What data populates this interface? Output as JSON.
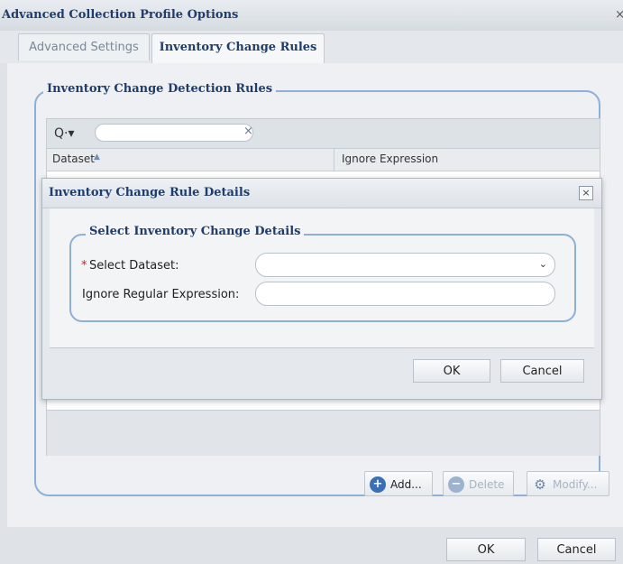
{
  "window": {
    "title": "Advanced Collection Profile Options",
    "close_glyph": "×",
    "close_icon": "close-icon"
  },
  "tabs": [
    {
      "label": "Advanced Settings",
      "active": false
    },
    {
      "label": "Inventory Change Rules",
      "active": true
    }
  ],
  "group": {
    "legend": "Inventory Change Detection Rules"
  },
  "grid": {
    "search_icon": "search-icon",
    "search_glyph": "Q·▾",
    "clear_glyph": "×",
    "search_value": "",
    "columns": [
      {
        "label": "Dataset",
        "sort": "ascending"
      },
      {
        "label": "Ignore Expression"
      }
    ],
    "sort_glyph": "▲",
    "rows": []
  },
  "actions": {
    "add": {
      "label": "Add...",
      "icon": "add-icon",
      "glyph": "+",
      "enabled": true
    },
    "delete": {
      "label": "Delete",
      "icon": "delete-icon",
      "glyph": "−",
      "enabled": false
    },
    "modify": {
      "label": "Modify...",
      "icon": "modify-icon",
      "glyph": "⚙",
      "enabled": false
    }
  },
  "footer": {
    "ok": "OK",
    "cancel": "Cancel"
  },
  "dialog": {
    "title": "Inventory Change Rule Details",
    "close_glyph": "×",
    "legend": "Select Inventory Change Details",
    "required_marker": "*",
    "dataset_label": "Select Dataset:",
    "dataset_value": "",
    "dropdown_glyph": "⌄",
    "ignore_label": "Ignore Regular Expression:",
    "ignore_value": "",
    "ok": "OK",
    "cancel": "Cancel"
  },
  "colors": {
    "title_text": "#1f3d6b",
    "group_border": "#8fb0d6",
    "required": "#d21f1f",
    "add_icon": "#3b6fb6"
  }
}
